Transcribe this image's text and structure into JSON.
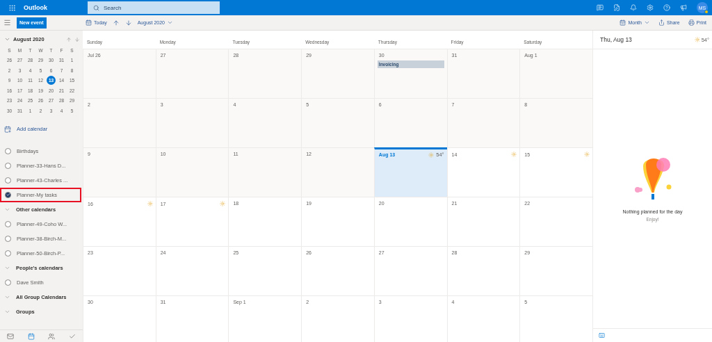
{
  "topbar": {
    "app_name": "Outlook",
    "search_placeholder": "Search",
    "avatar": "MS"
  },
  "command_bar": {
    "new_event": "New event",
    "today": "Today",
    "period": "August 2020",
    "view": "Month",
    "share": "Share",
    "print": "Print"
  },
  "mini_calendar": {
    "title": "August 2020",
    "weekdays": [
      "S",
      "M",
      "T",
      "W",
      "T",
      "F",
      "S"
    ],
    "weeks": [
      [
        {
          "label": "26",
          "selected": false
        },
        {
          "label": "27",
          "selected": false
        },
        {
          "label": "28",
          "selected": false
        },
        {
          "label": "29",
          "selected": false
        },
        {
          "label": "30",
          "selected": false
        },
        {
          "label": "31",
          "selected": false
        },
        {
          "label": "1",
          "selected": false
        }
      ],
      [
        {
          "label": "2",
          "selected": false
        },
        {
          "label": "3",
          "selected": false
        },
        {
          "label": "4",
          "selected": false
        },
        {
          "label": "5",
          "selected": false
        },
        {
          "label": "6",
          "selected": false
        },
        {
          "label": "7",
          "selected": false
        },
        {
          "label": "8",
          "selected": false
        }
      ],
      [
        {
          "label": "9",
          "selected": false
        },
        {
          "label": "10",
          "selected": false
        },
        {
          "label": "11",
          "selected": false
        },
        {
          "label": "12",
          "selected": false
        },
        {
          "label": "13",
          "selected": true
        },
        {
          "label": "14",
          "selected": false
        },
        {
          "label": "15",
          "selected": false
        }
      ],
      [
        {
          "label": "16",
          "selected": false
        },
        {
          "label": "17",
          "selected": false
        },
        {
          "label": "18",
          "selected": false
        },
        {
          "label": "19",
          "selected": false
        },
        {
          "label": "20",
          "selected": false
        },
        {
          "label": "21",
          "selected": false
        },
        {
          "label": "22",
          "selected": false
        }
      ],
      [
        {
          "label": "23",
          "selected": false
        },
        {
          "label": "24",
          "selected": false
        },
        {
          "label": "25",
          "selected": false
        },
        {
          "label": "26",
          "selected": false
        },
        {
          "label": "27",
          "selected": false
        },
        {
          "label": "28",
          "selected": false
        },
        {
          "label": "29",
          "selected": false
        }
      ],
      [
        {
          "label": "30",
          "selected": false
        },
        {
          "label": "31",
          "selected": false
        },
        {
          "label": "1",
          "selected": false
        },
        {
          "label": "2",
          "selected": false
        },
        {
          "label": "3",
          "selected": false
        },
        {
          "label": "4",
          "selected": false
        },
        {
          "label": "5",
          "selected": false
        }
      ]
    ]
  },
  "add_calendar": "Add calendar",
  "calendar_groups": [
    {
      "items": [
        {
          "name": "Birthdays",
          "checked": false,
          "outlined": false
        },
        {
          "name": "Planner-33-Hans D...",
          "checked": false,
          "outlined": false
        },
        {
          "name": "Planner-43-Charles ...",
          "checked": false,
          "outlined": false
        },
        {
          "name": "Planner-My tasks",
          "checked": true,
          "outlined": true
        }
      ]
    },
    {
      "title": "Other calendars",
      "items": [
        {
          "name": "Planner-49-Coho W...",
          "checked": false,
          "outlined": false
        },
        {
          "name": "Planner-38-Birch-M...",
          "checked": false,
          "outlined": false
        },
        {
          "name": "Planner-50-Birch-P...",
          "checked": false,
          "outlined": false
        }
      ]
    },
    {
      "title": "People's calendars",
      "items": [
        {
          "name": "Dave Smith",
          "checked": false,
          "outlined": false
        }
      ]
    },
    {
      "title": "All Group Calendars"
    },
    {
      "title": "Groups"
    }
  ],
  "month_grid": {
    "weekdays": [
      "Sunday",
      "Monday",
      "Tuesday",
      "Wednesday",
      "Thursday",
      "Friday",
      "Saturday"
    ],
    "weeks": [
      [
        {
          "label": "Jul 26",
          "past": true,
          "today": false,
          "weather": false
        },
        {
          "label": "27",
          "past": true,
          "today": false,
          "weather": false
        },
        {
          "label": "28",
          "past": true,
          "today": false,
          "weather": false
        },
        {
          "label": "29",
          "past": true,
          "today": false,
          "weather": false
        },
        {
          "label": "30",
          "past": true,
          "today": false,
          "weather": false,
          "events": [
            {
              "title": "Invoicing"
            }
          ]
        },
        {
          "label": "31",
          "past": true,
          "today": false,
          "weather": false
        },
        {
          "label": "Aug 1",
          "past": true,
          "today": false,
          "weather": false
        }
      ],
      [
        {
          "label": "2",
          "past": true,
          "today": false,
          "weather": false
        },
        {
          "label": "3",
          "past": true,
          "today": false,
          "weather": false
        },
        {
          "label": "4",
          "past": true,
          "today": false,
          "weather": false
        },
        {
          "label": "5",
          "past": true,
          "today": false,
          "weather": false
        },
        {
          "label": "6",
          "past": true,
          "today": false,
          "weather": false
        },
        {
          "label": "7",
          "past": true,
          "today": false,
          "weather": false
        },
        {
          "label": "8",
          "past": true,
          "today": false,
          "weather": false
        }
      ],
      [
        {
          "label": "9",
          "past": true,
          "today": false,
          "weather": false
        },
        {
          "label": "10",
          "past": true,
          "today": false,
          "weather": false
        },
        {
          "label": "11",
          "past": true,
          "today": false,
          "weather": false
        },
        {
          "label": "12",
          "past": true,
          "today": false,
          "weather": false
        },
        {
          "label": "Aug 13",
          "past": false,
          "today": true,
          "weather": true,
          "temp": "54°"
        },
        {
          "label": "14",
          "past": false,
          "today": false,
          "weather": true
        },
        {
          "label": "15",
          "past": false,
          "today": false,
          "weather": true
        }
      ],
      [
        {
          "label": "16",
          "past": false,
          "today": false,
          "weather": true
        },
        {
          "label": "17",
          "past": false,
          "today": false,
          "weather": true
        },
        {
          "label": "18",
          "past": false,
          "today": false,
          "weather": false
        },
        {
          "label": "19",
          "past": false,
          "today": false,
          "weather": false
        },
        {
          "label": "20",
          "past": false,
          "today": false,
          "weather": false
        },
        {
          "label": "21",
          "past": false,
          "today": false,
          "weather": false
        },
        {
          "label": "22",
          "past": false,
          "today": false,
          "weather": false
        }
      ],
      [
        {
          "label": "23",
          "past": false,
          "today": false,
          "weather": false
        },
        {
          "label": "24",
          "past": false,
          "today": false,
          "weather": false
        },
        {
          "label": "25",
          "past": false,
          "today": false,
          "weather": false
        },
        {
          "label": "26",
          "past": false,
          "today": false,
          "weather": false
        },
        {
          "label": "27",
          "past": false,
          "today": false,
          "weather": false
        },
        {
          "label": "28",
          "past": false,
          "today": false,
          "weather": false
        },
        {
          "label": "29",
          "past": false,
          "today": false,
          "weather": false
        }
      ],
      [
        {
          "label": "30",
          "past": false,
          "today": false,
          "weather": false
        },
        {
          "label": "31",
          "past": false,
          "today": false,
          "weather": false
        },
        {
          "label": "Sep 1",
          "past": false,
          "today": false,
          "weather": false
        },
        {
          "label": "2",
          "past": false,
          "today": false,
          "weather": false
        },
        {
          "label": "3",
          "past": false,
          "today": false,
          "weather": false
        },
        {
          "label": "4",
          "past": false,
          "today": false,
          "weather": false
        },
        {
          "label": "5",
          "past": false,
          "today": false,
          "weather": false
        }
      ]
    ]
  },
  "day_panel": {
    "title": "Thu, Aug 13",
    "temp": "54°",
    "empty_title": "Nothing planned for the day",
    "empty_subtitle": "Enjoy!"
  }
}
